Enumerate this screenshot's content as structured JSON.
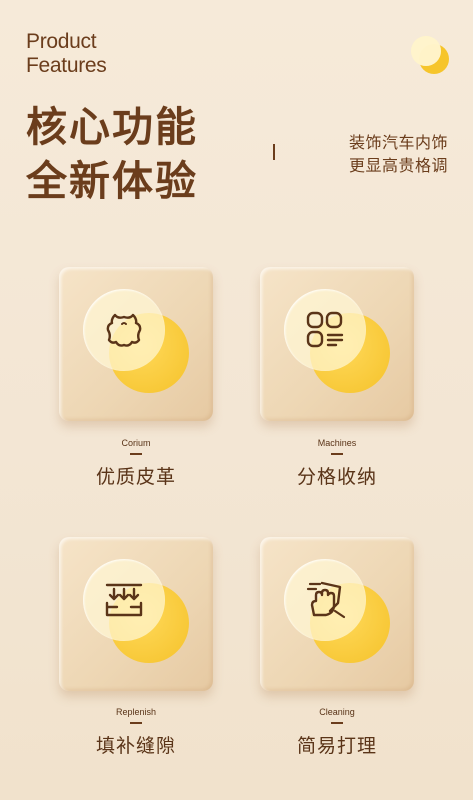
{
  "header": {
    "en_line1": "Product",
    "en_line2": "Features",
    "cn_line1": "核心功能",
    "cn_line2": "全新体验",
    "sub_line1": "装饰汽车内饰",
    "sub_line2": "更显高贵格调"
  },
  "features": [
    {
      "en": "Corium",
      "cn": "优质皮革",
      "icon": "leather-hide-icon"
    },
    {
      "en": "Machines",
      "cn": "分格收纳",
      "icon": "compartment-grid-icon"
    },
    {
      "en": "Replenish",
      "cn": "填补缝隙",
      "icon": "fill-gap-icon"
    },
    {
      "en": "Cleaning",
      "cn": "简易打理",
      "icon": "wipe-hand-icon"
    }
  ],
  "colors": {
    "brown": "#6b3d1c",
    "yellow": "#f5c22a",
    "background": "#f6ead9"
  }
}
